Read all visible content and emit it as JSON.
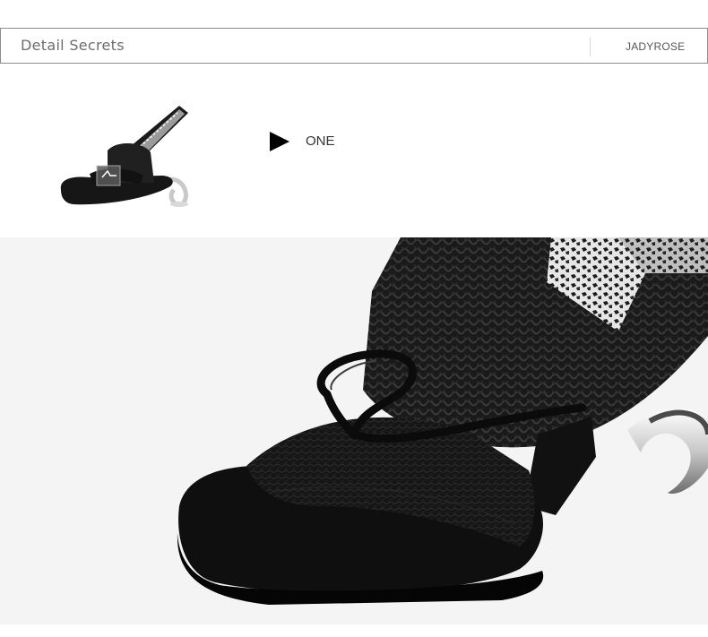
{
  "header": {
    "title": "Detail Secrets",
    "brand": "JADYROSE"
  },
  "section": {
    "step_label": "ONE",
    "step_icon": "play-triangle-icon"
  },
  "colors": {
    "border": "#8c8c8c",
    "hero_background": "#f4f4f4",
    "shoe_black": "#141414"
  }
}
